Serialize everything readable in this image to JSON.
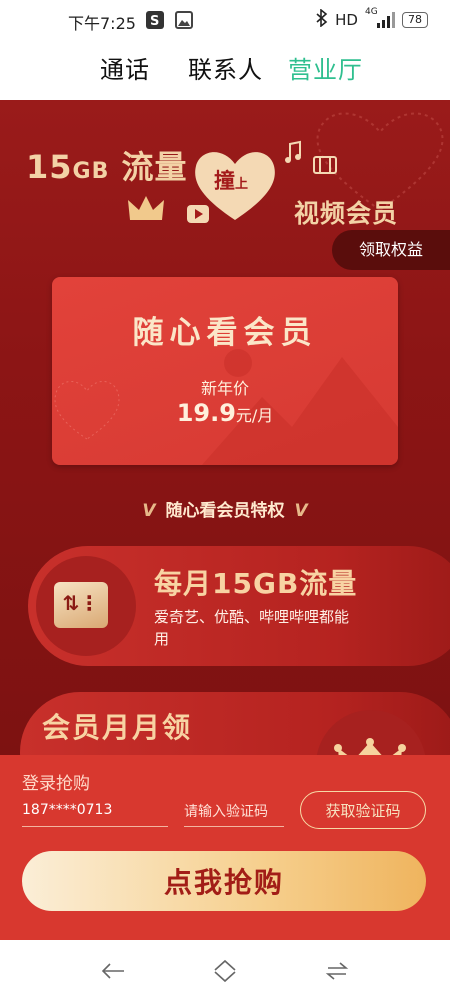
{
  "status_bar": {
    "time": "下午7:25",
    "network": "HD",
    "signal_label": "4G",
    "battery": "78",
    "icons": [
      "sogou-icon",
      "image-icon",
      "bluetooth-icon",
      "signal-icon",
      "battery-icon"
    ]
  },
  "tabs": [
    {
      "label": "通话",
      "active": false
    },
    {
      "label": "联系人",
      "active": false
    },
    {
      "label": "营业厅",
      "active": true
    }
  ],
  "banner": {
    "size_num": "15",
    "size_unit": "GB",
    "title_rest": " 流量",
    "heart_main": "撞",
    "heart_small": "上",
    "video_member": "视频会员",
    "claim_button": "领取权益"
  },
  "card": {
    "title": "随心看会员",
    "subtitle": "新年价",
    "price": "19.9",
    "unit": "元/月"
  },
  "privilege": {
    "title": "随心看会员特权",
    "chevron": "V"
  },
  "features": [
    {
      "title": "每月15GB流量",
      "desc": "爱奇艺、优酷、哔哩哔哩都能用",
      "icon": "ticket-icon",
      "icon_symbol": "⇅⋮"
    },
    {
      "title": "会员月月领",
      "icon": "crown-icon"
    }
  ],
  "form": {
    "label": "登录抢购",
    "phone": "187****0713",
    "code_placeholder": "请输入验证码",
    "get_code_button": "获取验证码",
    "buy_button": "点我抢购"
  },
  "nav": {
    "icons": [
      "back-icon",
      "home-icon",
      "recents-icon"
    ]
  },
  "colors": {
    "accent_green": "#2fbf8f",
    "bg_red": "#8c1515",
    "card_red": "#d63a33",
    "gold": "#f3d2a6",
    "button_gold": "#f6cf8d"
  }
}
